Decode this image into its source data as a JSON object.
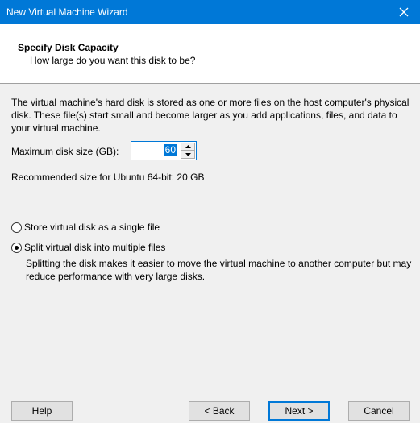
{
  "window": {
    "title": "New Virtual Machine Wizard"
  },
  "header": {
    "title": "Specify Disk Capacity",
    "subtitle": "How large do you want this disk to be?"
  },
  "main": {
    "description": "The virtual machine's hard disk is stored as one or more files on the host computer's physical disk. These file(s) start small and become larger as you add applications, files, and data to your virtual machine.",
    "max_size_label": "Maximum disk size (GB):",
    "max_size_value": "60",
    "recommended": "Recommended size for Ubuntu 64-bit: 20 GB",
    "options": [
      {
        "label": "Store virtual disk as a single file",
        "selected": false
      },
      {
        "label": "Split virtual disk into multiple files",
        "selected": true
      }
    ],
    "split_note": "Splitting the disk makes it easier to move the virtual machine to another computer but may reduce performance with very large disks."
  },
  "buttons": {
    "help": "Help",
    "back": "< Back",
    "next": "Next >",
    "cancel": "Cancel"
  },
  "colors": {
    "accent": "#0078d7"
  }
}
